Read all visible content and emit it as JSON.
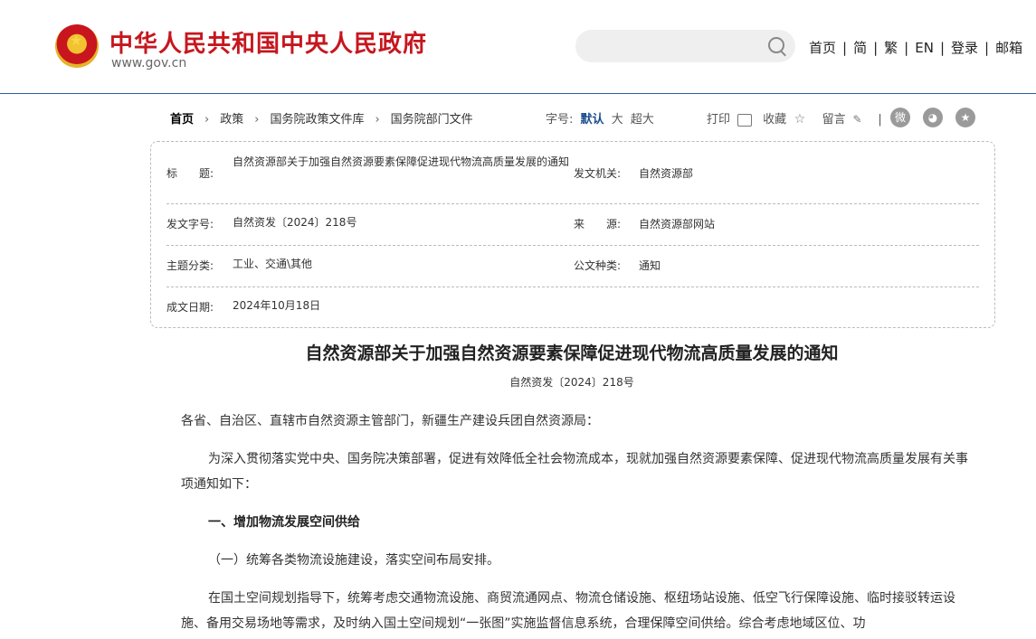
{
  "header": {
    "site_title": "中华人民共和国中央人民政府",
    "site_url": "www.gov.cn",
    "nav": [
      "首页",
      "简",
      "繁",
      "EN",
      "登录",
      "邮箱"
    ]
  },
  "breadcrumb": [
    "首页",
    "政策",
    "国务院政策文件库",
    "国务院部门文件"
  ],
  "tools": {
    "font_label": "字号:",
    "font_default": "默认",
    "font_large": "大",
    "font_xlarge": "超大",
    "print": "打印",
    "favorite": "收藏",
    "comment": "留言"
  },
  "meta": {
    "title_label": "标　　题:",
    "title_value": "自然资源部关于加强自然资源要素保障促进现代物流高质量发展的通知",
    "issuer_label": "发文机关:",
    "issuer_value": "自然资源部",
    "docno_label": "发文字号:",
    "docno_value": "自然资发〔2024〕218号",
    "source_label": "来　　源:",
    "source_value": "自然资源部网站",
    "topic_label": "主题分类:",
    "topic_value": "工业、交通\\其他",
    "type_label": "公文种类:",
    "type_value": "通知",
    "date_label": "成文日期:",
    "date_value": "2024年10月18日"
  },
  "article": {
    "title": "自然资源部关于加强自然资源要素保障促进现代物流高质量发展的通知",
    "doc_no": "自然资发〔2024〕218号",
    "salutation": "各省、自治区、直辖市自然资源主管部门，新疆生产建设兵团自然资源局：",
    "intro": "为深入贯彻落实党中央、国务院决策部署，促进有效降低全社会物流成本，现就加强自然资源要素保障、促进现代物流高质量发展有关事项通知如下：",
    "section1": "一、增加物流发展空间供给",
    "sub1": "（一）统筹各类物流设施建设，落实空间布局安排。",
    "para1": "在国土空间规划指导下，统筹考虑交通物流设施、商贸流通网点、物流仓储设施、枢纽场站设施、低空飞行保障设施、临时接驳转运设施、备用交易场地等需求，及时纳入国土空间规划“一张图”实施监督信息系统，合理保障空间供给。综合考虑地域区位、功"
  }
}
